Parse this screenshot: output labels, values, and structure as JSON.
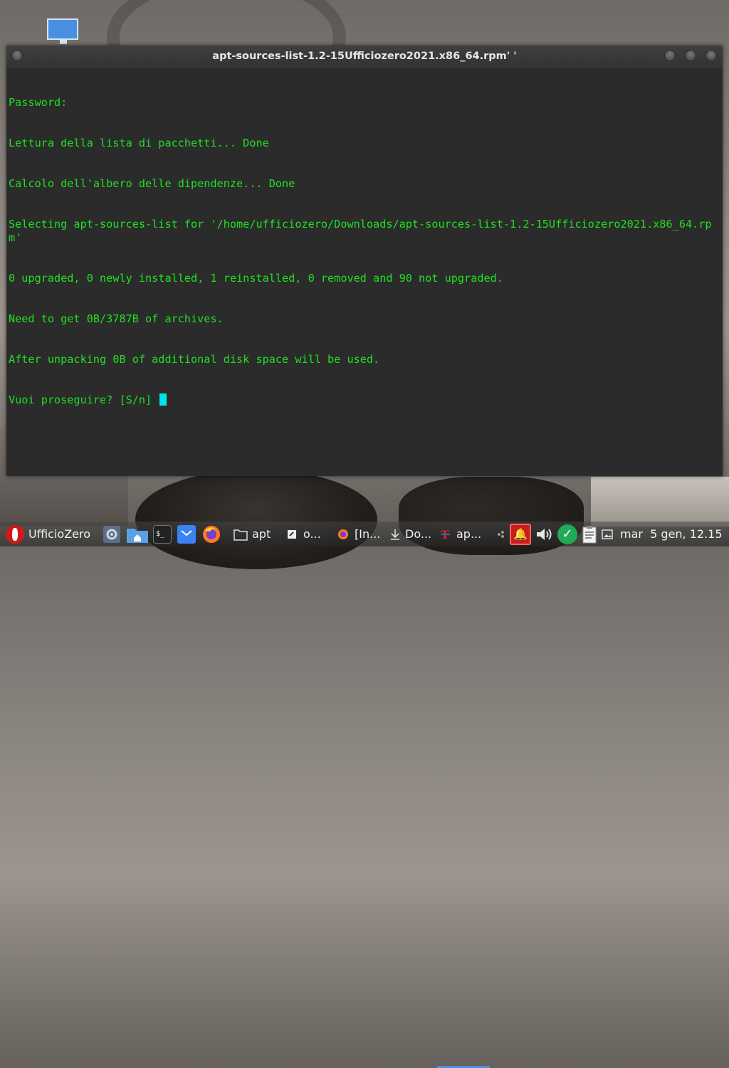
{
  "window": {
    "title": "apt-sources-list-1.2-15Ufficiozero2021.x86_64.rpm' '"
  },
  "terminal": {
    "lines": [
      "Password:",
      "Lettura della lista di pacchetti... Done",
      "Calcolo dell'albero delle dipendenze... Done",
      "Selecting apt-sources-list for '/home/ufficiozero/Downloads/apt-sources-list-1.2-15Ufficiozero2021.x86_64.rpm'",
      "0 upgraded, 0 newly installed, 1 reinstalled, 0 removed and 90 not upgraded.",
      "Need to get 0B/3787B of archives.",
      "After unpacking 0B of additional disk space will be used.",
      "Vuoi proseguire? [S/n] "
    ],
    "text_color": "#20e020",
    "cursor_color": "#00e5e5"
  },
  "taskbar": {
    "start_label": "UfficioZero",
    "tasks": [
      {
        "icon": "folder-icon",
        "label": "apt"
      },
      {
        "icon": "editor-icon",
        "label": "o..."
      },
      {
        "icon": "firefox-icon",
        "label": "[In..."
      },
      {
        "icon": "download-icon",
        "label": "Do..."
      },
      {
        "icon": "terminal-app-icon",
        "label": "ap..."
      }
    ],
    "clock": "mar  5 gen, 12.15"
  },
  "colors": {
    "window_bg": "#2b2b2b",
    "accent": "#4a90e2",
    "bell_red": "#c81e1e",
    "check_green": "#22aa55"
  }
}
